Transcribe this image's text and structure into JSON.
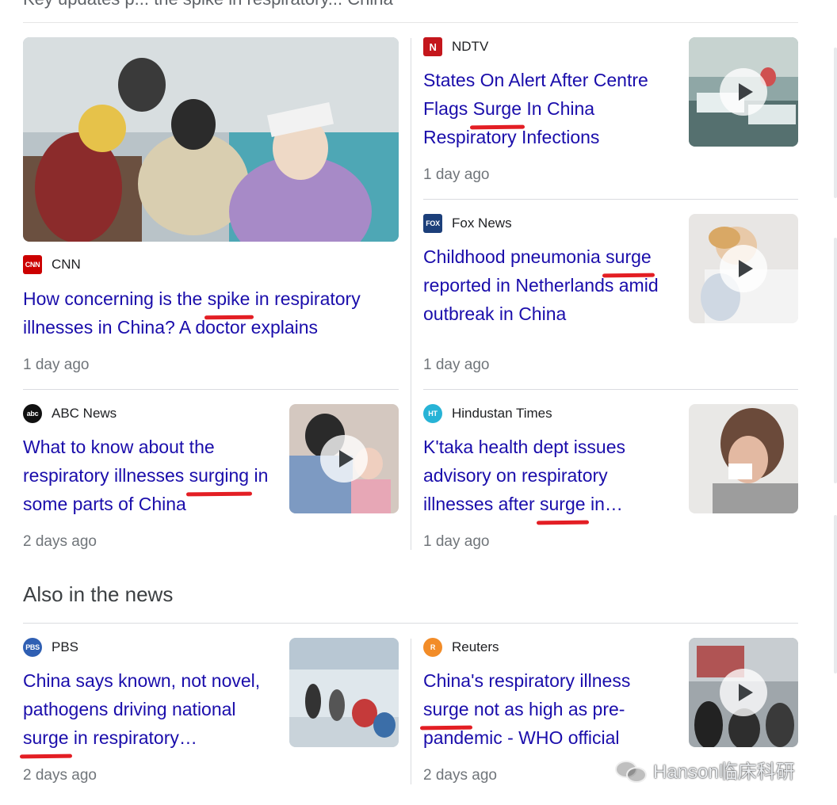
{
  "top_cut_text": "Key updates p... the spike in respiratory... China",
  "section_heading": "Also in the news",
  "watermark": "Hanson临床科研",
  "articles": [
    {
      "source": "CNN",
      "logo": {
        "text": "CNN",
        "bg": "#cc0000"
      },
      "title_pre": "How concerning is the ",
      "title_hl": "spike",
      "title_post": " in respiratory illnesses in China? A doctor explains",
      "time": "1 day ago",
      "has_video": false,
      "image": "crowded-hospital-waiting-room"
    },
    {
      "source": "NDTV",
      "logo": {
        "text": "N",
        "bg": "#c4161c"
      },
      "title_pre": "States On Alert After Centre Flags ",
      "title_hl": "Surge",
      "title_post": " In China Respiratory Infections",
      "time": "1 day ago",
      "has_video": true,
      "image": "hospital-ward-beds"
    },
    {
      "source": "Fox News",
      "logo": {
        "text": "FOX",
        "bg": "#1c3f7a"
      },
      "title_pre": "Childhood pneumonia ",
      "title_hl": "surge",
      "title_post": " reported in Netherlands amid outbreak in China",
      "time": "1 day ago",
      "has_video": true,
      "image": "child-in-hospital-bed"
    },
    {
      "source": "ABC News",
      "logo": {
        "text": "abc",
        "bg": "#111111"
      },
      "title_pre": "What to know about the respiratory illnesses ",
      "title_hl": "surging",
      "title_post": " in some parts of China",
      "time": "2 days ago",
      "has_video": true,
      "image": "parent-and-child-waiting"
    },
    {
      "source": "Hindustan Times",
      "logo": {
        "text": "HT",
        "bg": "#27b3d6"
      },
      "title_pre": "K'taka health dept issues advisory on respiratory illnesses after ",
      "title_hl": "surge",
      "title_post": " in…",
      "time": "1 day ago",
      "has_video": false,
      "image": "woman-blowing-nose"
    },
    {
      "source": "PBS",
      "logo": {
        "text": "PBS",
        "bg": "#2f5fb3"
      },
      "title_pre": "China says known, not novel, pathogens driving national ",
      "title_hl": "surge",
      "title_post": " in respiratory…",
      "time": "2 days ago",
      "has_video": false,
      "image": "hospital-corridor-crowd"
    },
    {
      "source": "Reuters",
      "logo": {
        "text": "R",
        "bg": "#f28c28"
      },
      "title_pre": "China's respiratory illness ",
      "title_hl": "surge",
      "title_post": " not as high as pre-pandemic - WHO official",
      "time": "2 days ago",
      "has_video": true,
      "image": "people-outside-hospital"
    }
  ],
  "colors": {
    "link": "#1a0dab",
    "meta": "#70757a",
    "highlight_underline": "#e31e24",
    "divider": "#dadce0"
  }
}
